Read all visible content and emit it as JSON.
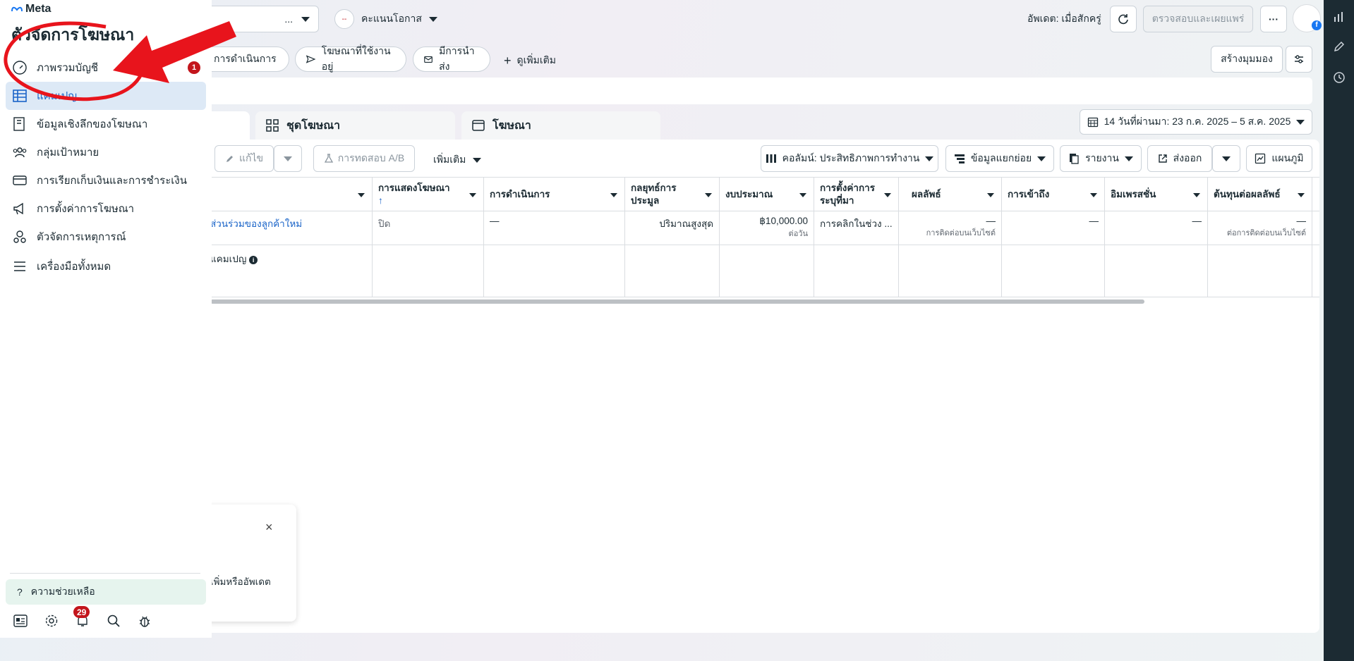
{
  "brand": {
    "logo_text": "Meta",
    "title": "ตัวจัดการโฆษณา"
  },
  "sidebar": {
    "items": [
      {
        "label": "ภาพรวมบัญชี",
        "badge": "1"
      },
      {
        "label": "แคมเปญ"
      },
      {
        "label": "ข้อมูลเชิงลึกของโฆษณา"
      },
      {
        "label": "กลุ่มเป้าหมาย"
      },
      {
        "label": "การเรียกเก็บเงินและการชำระเงิน"
      },
      {
        "label": "การตั้งค่าการโฆษณา"
      },
      {
        "label": "ตัวจัดการเหตุการณ์"
      },
      {
        "label": "เครื่องมือทั้งหมด"
      }
    ],
    "help_label": "ความช่วยเหลือ",
    "notifications_count": "29"
  },
  "topbar": {
    "account_selector_text": "...",
    "opportunity_label": "คะแนนโอกาส",
    "updated_text": "อัพเดต: เมื่อสักครู่",
    "review_publish_label": "ตรวจสอบและเผยแพร่",
    "more_label": "···"
  },
  "filters": {
    "chips": [
      "การดำเนินการ",
      "โฆษณาที่ใช้งานอยู่",
      "มีการนำส่ง",
      "ดูเพิ่มเติม"
    ],
    "create_view_label": "สร้างมุมมอง"
  },
  "tabs": [
    {
      "label": "ชุดโฆษณา"
    },
    {
      "label": "โฆษณา"
    }
  ],
  "date_range": "14 วันที่ผ่านมา: 23 ก.ค. 2025 – 5 ส.ค. 2025",
  "toolbar": {
    "edit_label": "แก้ไข",
    "ab_test_label": "การทดสอบ A/B",
    "more_label": "เพิ่มเติม",
    "columns_label": "คอลัมน์: ประสิทธิภาพการทำงาน",
    "breakdown_label": "ข้อมูลแยกย่อย",
    "reports_label": "รายงาน",
    "export_label": "ส่งออก",
    "charts_label": "แผนภูมิ"
  },
  "table": {
    "headers": [
      "การแสดงโฆษณา",
      "การดำเนินการ",
      "กลยุทธ์การประมูล",
      "งบประมาณ",
      "การตั้งค่าการระบุที่มา",
      "ผลลัพธ์",
      "การเข้าถึง",
      "อิมเพรสชั่น",
      "ต้นทุนต่อผลลัพธ์"
    ],
    "row": {
      "name": "ส่วนร่วมของลูกค้าใหม่",
      "delivery": "ปิด",
      "actions": "—",
      "bid_strategy": "ปริมาณสูงสุด",
      "budget": "฿10,000.00",
      "budget_sub": "ต่อวัน",
      "attribution": "การคลิกในช่วง ...",
      "results": "—",
      "results_sub": "การติดต่อบนเว็บไซต์",
      "reach": "—",
      "impressions": "—",
      "cost_per_result": "—",
      "cost_sub": "ต่อการติดต่อบนเว็บไซต์"
    },
    "summary_label": "แคมเปญ"
  },
  "popup": {
    "text": "เพิ่มหรืออัพเดต"
  },
  "annotation": {
    "color": "#e8141c"
  }
}
